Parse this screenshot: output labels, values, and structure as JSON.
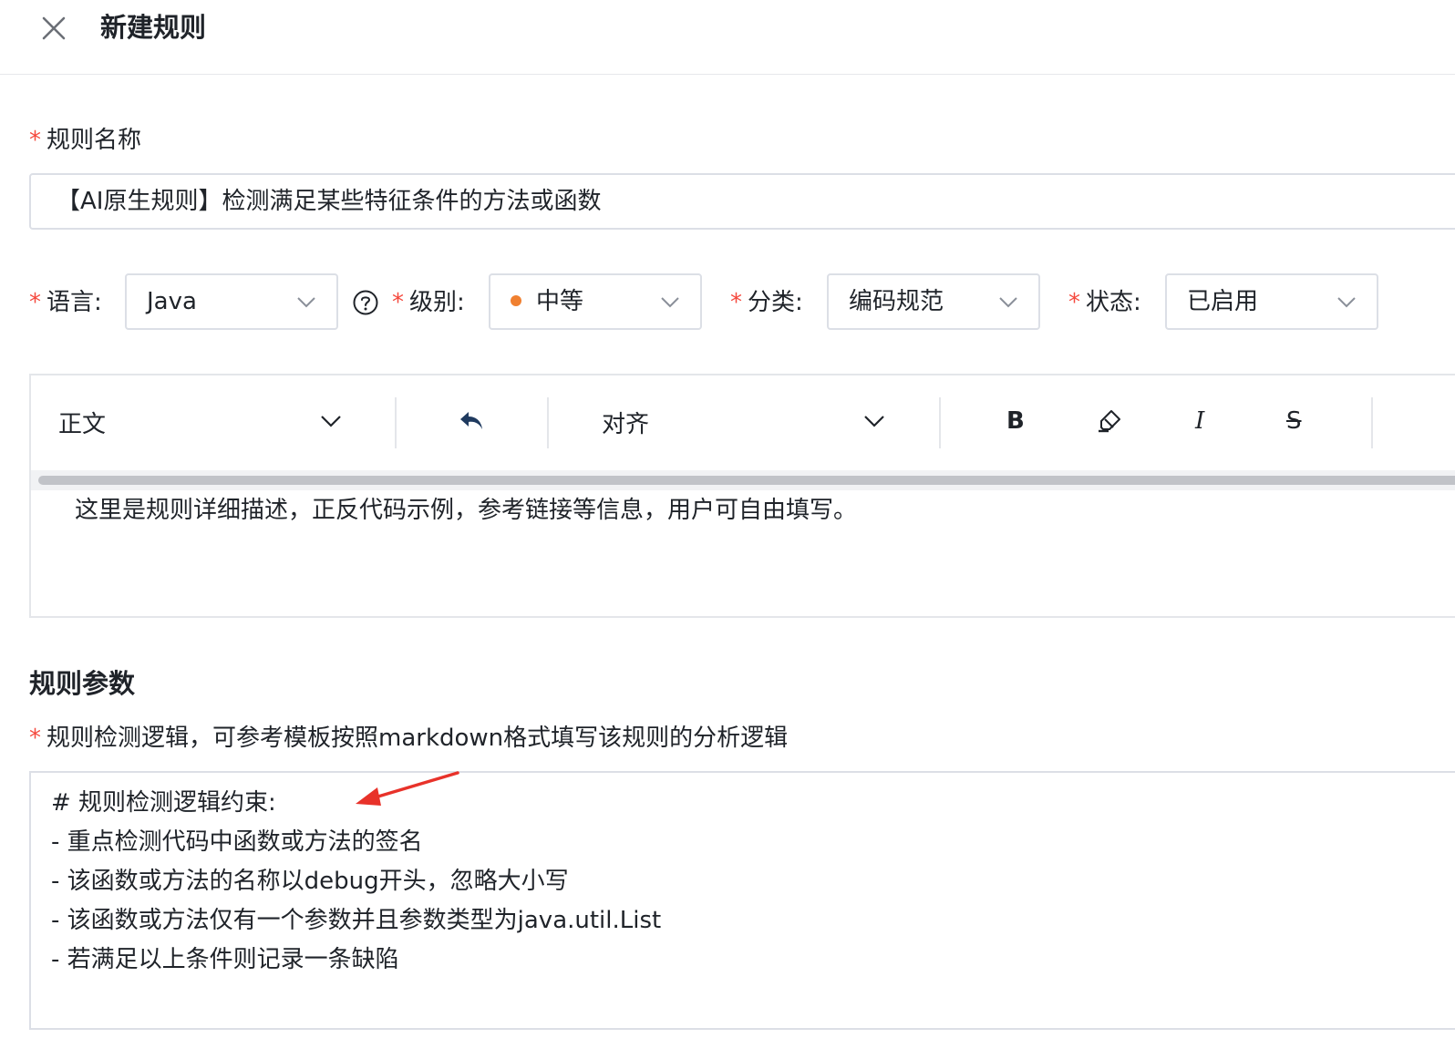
{
  "header": {
    "title": "新建规则"
  },
  "rule_name": {
    "required_mark": "*",
    "label": "规则名称",
    "value": "【AI原生规则】检测满足某些特征条件的方法或函数"
  },
  "filters": {
    "language": {
      "required_mark": "*",
      "label": "语言:",
      "value": "Java"
    },
    "level": {
      "required_mark": "*",
      "label": "级别:",
      "value": "中等",
      "dot_color": "#f08030"
    },
    "category": {
      "required_mark": "*",
      "label": "分类:",
      "value": "编码规范"
    },
    "status": {
      "required_mark": "*",
      "label": "状态:",
      "value": "已启用"
    }
  },
  "editor": {
    "toolbar": {
      "paragraph_style": "正文",
      "align": "对齐",
      "bold": "B",
      "italic": "I",
      "strike": "S"
    },
    "content": "这里是规则详细描述，正反代码示例，参考链接等信息，用户可自由填写。"
  },
  "params": {
    "section_title": "规则参数",
    "required_mark": "*",
    "logic_label": "规则检测逻辑，可参考模板按照markdown格式填写该规则的分析逻辑",
    "logic_lines": [
      "# 规则检测逻辑约束:",
      "- 重点检测代码中函数或方法的签名",
      "- 该函数或方法的名称以debug开头，忽略大小写",
      "- 该函数或方法仅有一个参数并且参数类型为java.util.List",
      "- 若满足以上条件则记录一条缺陷"
    ]
  },
  "colors": {
    "required": "#f5493e",
    "arrow": "#e8322a",
    "level_dot": "#f08030"
  }
}
